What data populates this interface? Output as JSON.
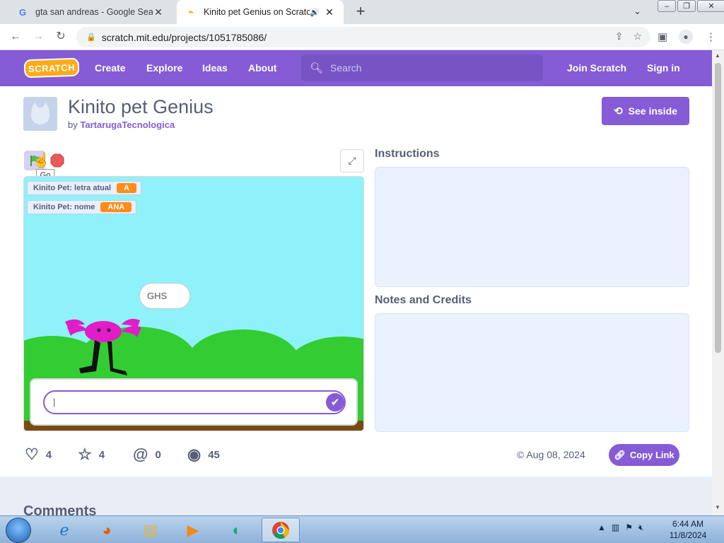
{
  "browser": {
    "tabs": [
      {
        "title": "gta san andreas - Google Search",
        "favicon": "G"
      },
      {
        "title": "Kinito pet Genius on Scratch"
      }
    ],
    "url": "scratch.mit.edu/projects/1051785086/"
  },
  "scratch_nav": {
    "logo": "SCRATCH",
    "links": [
      "Create",
      "Explore",
      "Ideas",
      "About"
    ],
    "search_placeholder": "Search",
    "join": "Join Scratch",
    "signin": "Sign in"
  },
  "project": {
    "title": "Kinito pet Genius",
    "by_label": "by",
    "author": "TartarugaTecnologica",
    "see_inside": "See inside",
    "go_tooltip": "Go",
    "monitors": [
      {
        "label": "Kinito Pet: letra atual",
        "value": "A"
      },
      {
        "label": "Kinito Pet: nome",
        "value": "ANA"
      }
    ],
    "speech": "GHS",
    "ask_input_value": "|",
    "instructions_heading": "Instructions",
    "notes_heading": "Notes and Credits",
    "stats": {
      "loves": "4",
      "favorites": "4",
      "remixes": "0",
      "views": "45"
    },
    "shared_date": "© Aug 08, 2024",
    "copy_link": "Copy Link",
    "comments_heading": "Comments"
  },
  "taskbar": {
    "time": "6:44 AM",
    "date": "11/8/2024"
  },
  "colors": {
    "scratch_purple": "#855cd6",
    "monitor_orange": "#ff8c1a",
    "stage_sky": "#8ff1f9",
    "hills": "#33cc33"
  }
}
